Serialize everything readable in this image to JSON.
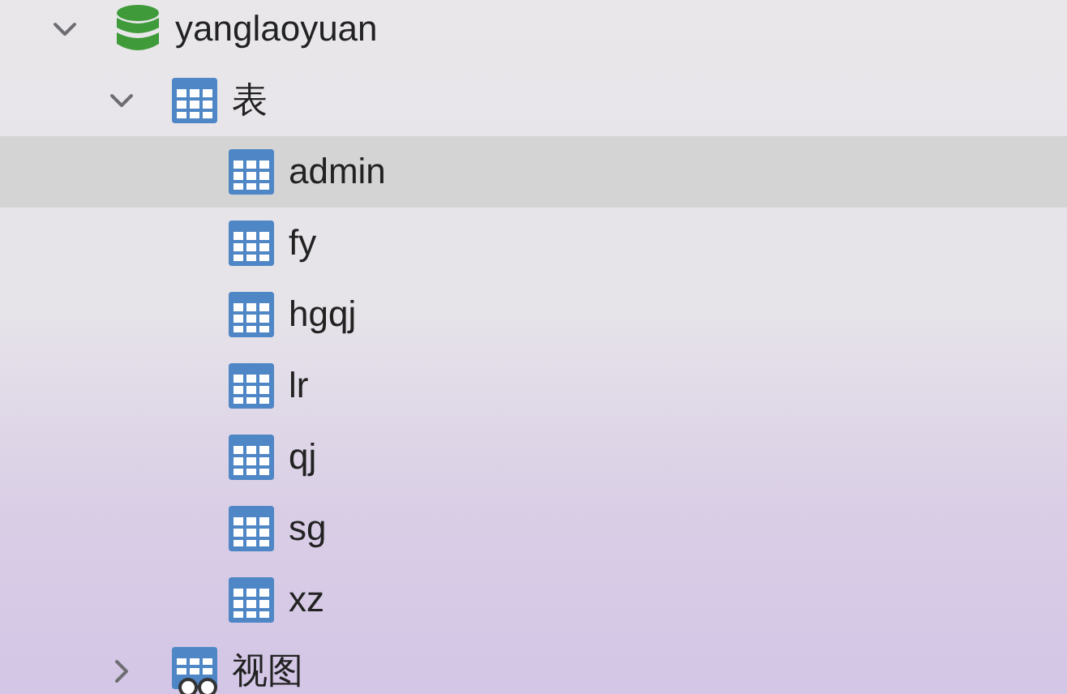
{
  "tree": [
    {
      "label": "yanglaoyuan",
      "kind": "database",
      "expanded": true,
      "selected": false,
      "children": [
        {
          "label": "表",
          "kind": "table-group",
          "expanded": true,
          "selected": false,
          "children": [
            {
              "label": "admin",
              "kind": "table",
              "selected": true
            },
            {
              "label": "fy",
              "kind": "table",
              "selected": false
            },
            {
              "label": "hgqj",
              "kind": "table",
              "selected": false
            },
            {
              "label": "lr",
              "kind": "table",
              "selected": false
            },
            {
              "label": "qj",
              "kind": "table",
              "selected": false
            },
            {
              "label": "sg",
              "kind": "table",
              "selected": false
            },
            {
              "label": "xz",
              "kind": "table",
              "selected": false
            }
          ]
        },
        {
          "label": "视图",
          "kind": "view-group",
          "expanded": false,
          "selected": false
        }
      ]
    }
  ]
}
